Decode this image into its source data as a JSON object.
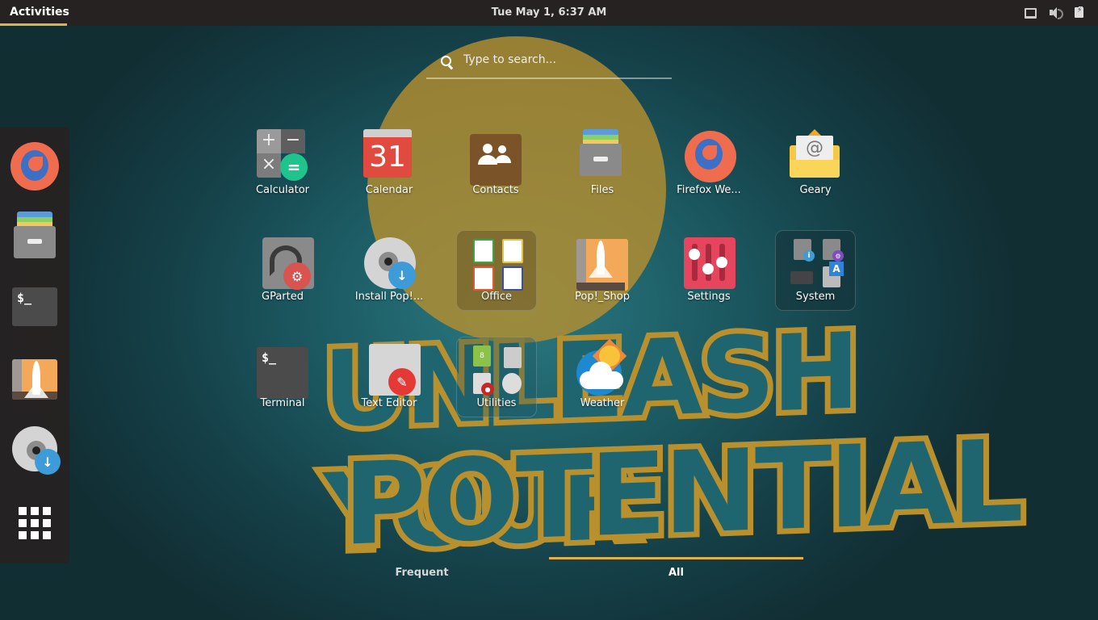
{
  "topbar": {
    "activities_label": "Activities",
    "clock": "Tue May  1, 6:37 AM",
    "tray_icons": [
      "display-icon",
      "volume-icon",
      "battery-icon"
    ]
  },
  "search": {
    "placeholder": "Type to search...",
    "value": ""
  },
  "dash": {
    "items": [
      {
        "name": "Firefox Web Browser",
        "icon": "firefox-icon"
      },
      {
        "name": "Files",
        "icon": "files-icon"
      },
      {
        "name": "Terminal",
        "icon": "terminal-icon"
      },
      {
        "name": "Pop!_Shop",
        "icon": "pop-shop-icon"
      },
      {
        "name": "Install Pop!_OS",
        "icon": "install-disc-icon"
      },
      {
        "name": "Show Applications",
        "icon": "app-grid-icon"
      }
    ]
  },
  "apps": [
    {
      "label": "Calculator",
      "icon": "calculator-icon"
    },
    {
      "label": "Calendar",
      "icon": "calendar-icon",
      "calendar_day": "31"
    },
    {
      "label": "Contacts",
      "icon": "contacts-icon"
    },
    {
      "label": "Files",
      "icon": "files-icon"
    },
    {
      "label": "Firefox We...",
      "icon": "firefox-icon"
    },
    {
      "label": "Geary",
      "icon": "geary-mail-icon"
    },
    {
      "label": "GParted",
      "icon": "gparted-icon"
    },
    {
      "label": "Install Pop!...",
      "icon": "install-disc-icon"
    },
    {
      "label": "Office",
      "icon": "folder-icon",
      "is_folder": true
    },
    {
      "label": "Pop!_Shop",
      "icon": "pop-shop-icon"
    },
    {
      "label": "Settings",
      "icon": "settings-sliders-icon"
    },
    {
      "label": "System",
      "icon": "folder-icon",
      "is_folder": true
    },
    {
      "label": "Terminal",
      "icon": "terminal-icon"
    },
    {
      "label": "Text Editor",
      "icon": "text-editor-icon"
    },
    {
      "label": "Utilities",
      "icon": "folder-icon",
      "is_folder": true
    },
    {
      "label": "Weather",
      "icon": "weather-icon"
    }
  ],
  "terminal_prompt": "$_",
  "utilities_archive_text": "8",
  "system_lang_letter": "A",
  "tabs": [
    {
      "label": "Frequent",
      "active": false
    },
    {
      "label": "All",
      "active": true
    }
  ],
  "colors": {
    "accent": "#e2b04a",
    "topbar_bg": "#252221",
    "dash_bg": "#252221",
    "wallpaper_teal": "#1c5a62",
    "wallpaper_gold": "#b8902e"
  },
  "wallpaper": {
    "text_line1": "UNLEASH YOUR",
    "text_line2": "POTENTIAL"
  }
}
